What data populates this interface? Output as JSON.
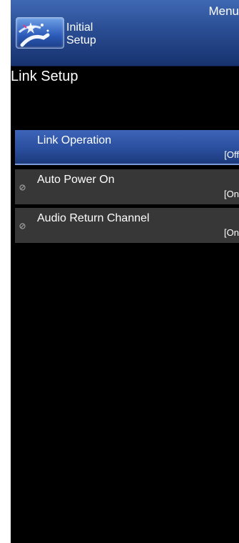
{
  "header": {
    "menu_label": "Menu",
    "section_label_line1": "Initial",
    "section_label_line2": "Setup",
    "icon": "initial-setup-icon"
  },
  "page": {
    "title": "Link Setup"
  },
  "items": [
    {
      "label": "Link Operation",
      "value": "[Off",
      "selected": true,
      "disabled": false
    },
    {
      "label": "Auto Power On",
      "value": "[On",
      "selected": false,
      "disabled": true,
      "icon": "disabled-icon"
    },
    {
      "label": "Audio Return Channel",
      "value": "[On",
      "selected": false,
      "disabled": true,
      "icon": "disabled-icon"
    }
  ],
  "colors": {
    "header_blue": "#2a4d93",
    "selected_blue": "#2b4f9f",
    "item_gray": "#373737",
    "background": "#000000",
    "text": "#ffffff"
  }
}
